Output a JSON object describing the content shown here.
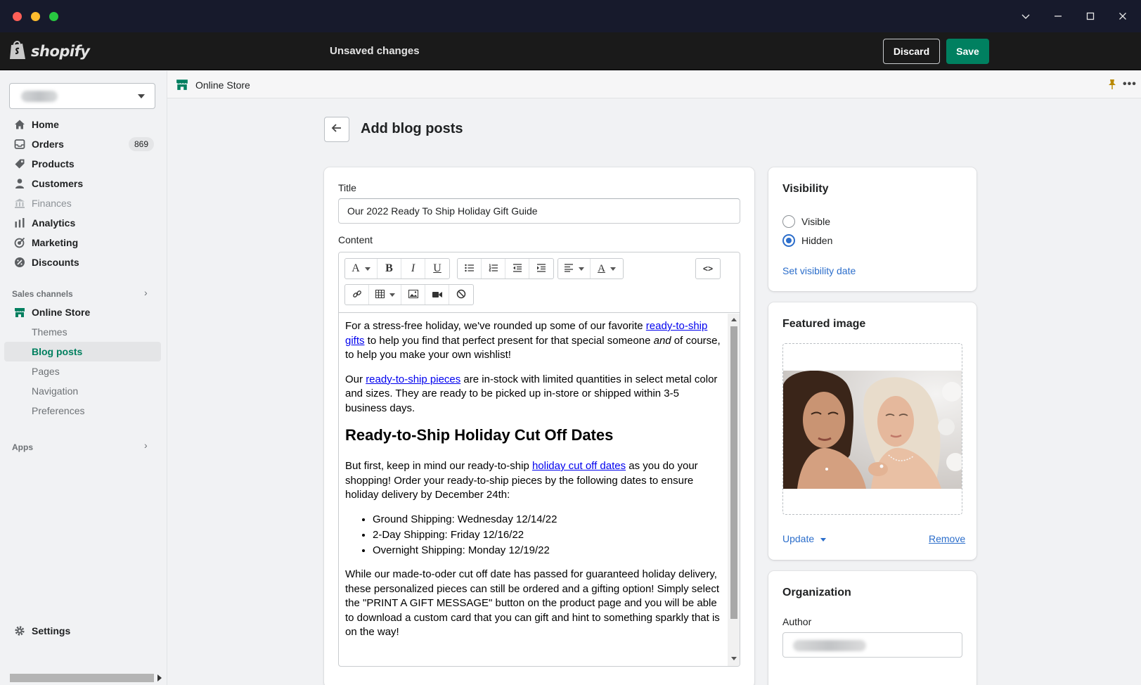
{
  "window": {
    "controls": [
      "chevron-down",
      "minimize",
      "maximize",
      "close"
    ]
  },
  "header": {
    "logo_text": "shopify",
    "status": "Unsaved changes",
    "discard_label": "Discard",
    "save_label": "Save",
    "save_color": "#008060"
  },
  "sidebar": {
    "nav": [
      {
        "label": "Home",
        "icon": "home-icon"
      },
      {
        "label": "Orders",
        "icon": "orders-icon",
        "badge": "869"
      },
      {
        "label": "Products",
        "icon": "tag-icon"
      },
      {
        "label": "Customers",
        "icon": "person-icon"
      },
      {
        "label": "Finances",
        "icon": "bank-icon",
        "disabled": true
      },
      {
        "label": "Analytics",
        "icon": "bar-chart-icon"
      },
      {
        "label": "Marketing",
        "icon": "target-icon"
      },
      {
        "label": "Discounts",
        "icon": "discount-icon"
      }
    ],
    "sales_channels_label": "Sales channels",
    "online_store_label": "Online Store",
    "online_store_sub": [
      "Themes",
      "Blog posts",
      "Pages",
      "Navigation",
      "Preferences"
    ],
    "active_sub": "Blog posts",
    "apps_label": "Apps",
    "settings_label": "Settings"
  },
  "breadcrumb": {
    "label": "Online Store"
  },
  "page": {
    "title": "Add blog posts"
  },
  "post": {
    "title_label": "Title",
    "title_value": "Our 2022 Ready To Ship Holiday Gift Guide",
    "content_label": "Content",
    "content": {
      "p1_before": "For a stress-free holiday, we've rounded up some of our favorite ",
      "p1_link": "ready-to-ship gifts",
      "p1_mid": " to help you find that perfect present for that special someone ",
      "p1_em": "and",
      "p1_after": " of course, to help you make your own wishlist!",
      "p2_before": "Our ",
      "p2_link": "ready-to-ship pieces",
      "p2_after": " are in-stock with limited quantities in select metal color and sizes. They are ready to be picked up in-store or shipped within 3-5 business days.",
      "heading": "Ready-to-Ship Holiday Cut Off Dates",
      "p3_before": "But first, keep in mind our ready-to-ship ",
      "p3_link": "holiday cut off dates",
      "p3_after": " as you do your shopping! Order your ready-to-ship pieces by the following dates to ensure holiday delivery by December 24th:",
      "list": [
        "Ground Shipping: Wednesday 12/14/22",
        "2-Day Shipping: Friday 12/16/22",
        "Overnight Shipping: Monday 12/19/22"
      ],
      "p4": "While our made-to-oder cut off date has passed for guaranteed holiday delivery, these personalized pieces can still be ordered and a gifting option! Simply select the \"PRINT A GIFT MESSAGE\" button on the product page and you will be able to download a custom card that you can gift and hint to something sparkly that is on the way!"
    }
  },
  "visibility": {
    "title": "Visibility",
    "options": [
      "Visible",
      "Hidden"
    ],
    "selected": "Hidden",
    "set_date_link": "Set visibility date"
  },
  "featured_image": {
    "title": "Featured image",
    "update_label": "Update",
    "remove_label": "Remove"
  },
  "organization": {
    "title": "Organization",
    "author_label": "Author"
  },
  "colors": {
    "accent_green": "#008060",
    "link_blue": "#2c6ecb"
  }
}
